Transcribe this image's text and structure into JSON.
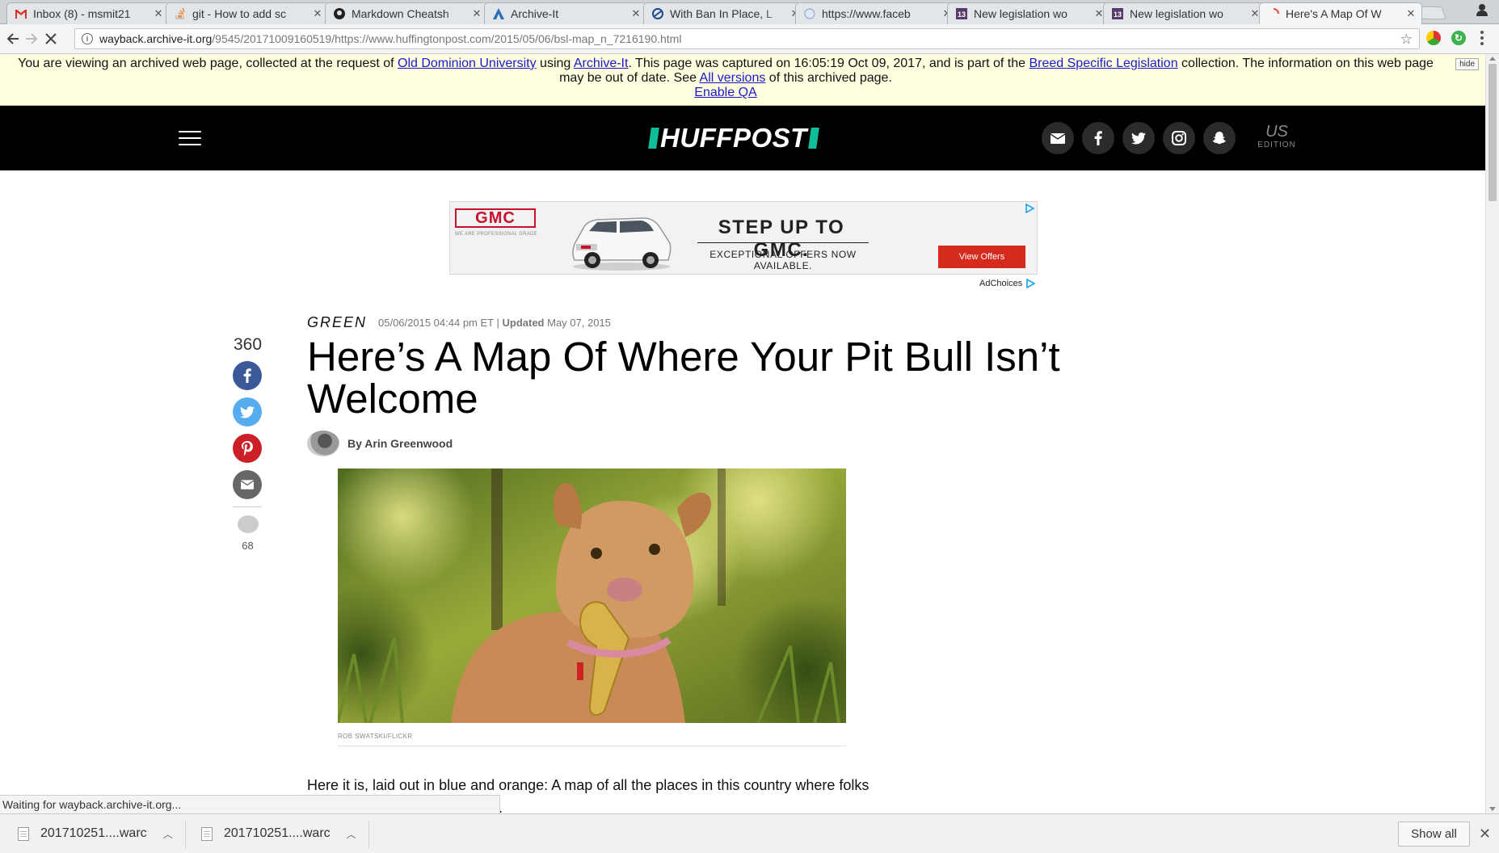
{
  "browser": {
    "tabs": [
      {
        "title": "Inbox (8) - msmit21",
        "icon": "gmail-icon"
      },
      {
        "title": "git - How to add sc",
        "icon": "stackoverflow-icon"
      },
      {
        "title": "Markdown Cheatsh",
        "icon": "github-icon"
      },
      {
        "title": "Archive-It",
        "icon": "archive-it-icon"
      },
      {
        "title": "With Ban In Place, L",
        "icon": "site-icon"
      },
      {
        "title": "https://www.faceb",
        "icon": "globe-icon"
      },
      {
        "title": "New legislation wo",
        "icon": "news-icon"
      },
      {
        "title": "New legislation wo",
        "icon": "news-icon"
      },
      {
        "title": "Here's A Map Of W",
        "icon": "loading-icon",
        "active": true
      }
    ],
    "url_host": "wayback.archive-it.org",
    "url_path": "/9545/20171009160519/https://www.huffingtonpost.com/2015/05/06/bsl-map_n_7216190.html",
    "status_text": "Waiting for wayback.archive-it.org..."
  },
  "archive_banner": {
    "t1": "You are viewing an archived web page, collected at the request of ",
    "link1": "Old Dominion University",
    "t2": " using ",
    "link2": "Archive-It",
    "t3": ". This page was captured on 16:05:19 Oct 09, 2017, and is part of the ",
    "link3": "Breed Specific Legislation",
    "t4": " collection. The information on this web page may be out of date. See ",
    "link4": "All versions",
    "t5": " of this archived page.",
    "enable_qa": "Enable QA",
    "hide": "hide"
  },
  "header": {
    "logo": "HUFFPOST",
    "edition_code": "US",
    "edition_label": "EDITION"
  },
  "ad": {
    "brand": "GMC",
    "brand_tagline": "WE ARE PROFESSIONAL GRADE",
    "headline": "STEP UP TO GMC.",
    "subline": "EXCEPTIONAL OFFERS NOW AVAILABLE.",
    "cta": "View Offers",
    "adchoices": "AdChoices"
  },
  "article": {
    "section": "GREEN",
    "published": "05/06/2015 04:44 pm ET",
    "separator": " | ",
    "updated_label": "Updated",
    "updated_date": "May 07, 2015",
    "title": "Here’s A Map Of Where Your Pit Bull Isn’t Welcome",
    "byline": "By Arin Greenwood",
    "photo_credit": "ROB SWATSKI/FLICKR",
    "body_line": "Here it is, laid out in blue and orange: A map of all the places in this country where folks",
    "body_cut": "."
  },
  "share": {
    "count": "360",
    "comments": "68"
  },
  "downloads": {
    "items": [
      "201710251....warc",
      "201710251....warc"
    ],
    "show_all": "Show all"
  },
  "colors": {
    "facebook": "#3b5998",
    "twitter": "#55acee",
    "pinterest": "#cb2027",
    "email": "#666666",
    "huffpost_green": "#0dbe98",
    "ad_red": "#d52b1e"
  }
}
